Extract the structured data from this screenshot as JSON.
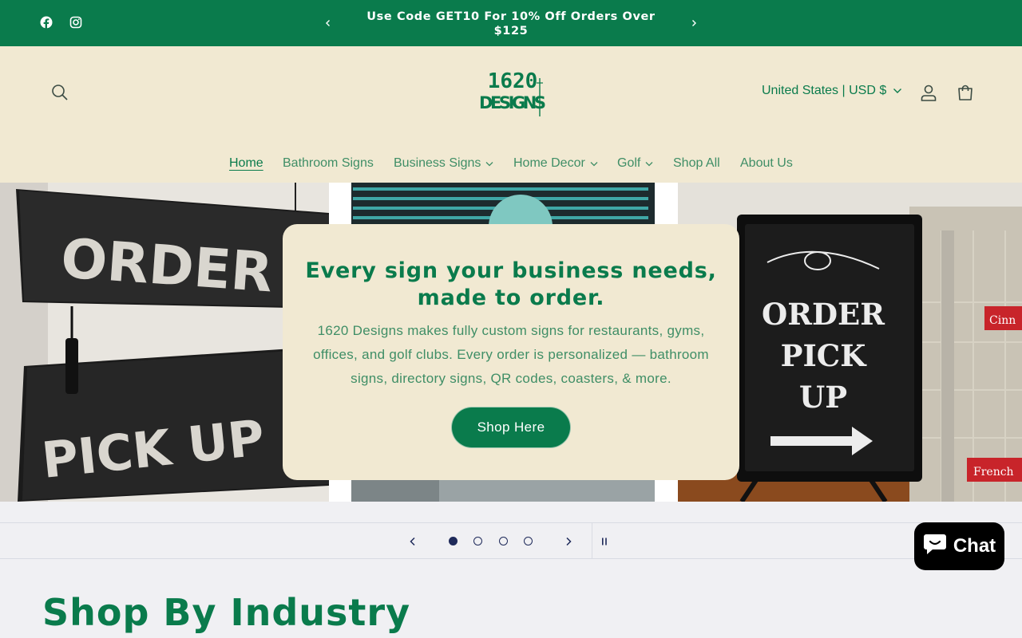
{
  "announcement": {
    "text": "Use Code GET10 For 10% Off Orders Over $125",
    "social": [
      "facebook-icon",
      "instagram-icon"
    ]
  },
  "header": {
    "logo_text_top": "1620",
    "logo_text_bottom": "DESIGNS",
    "country": "United States | USD $"
  },
  "nav": {
    "items": [
      {
        "label": "Home",
        "active": true
      },
      {
        "label": "Bathroom Signs"
      },
      {
        "label": "Business Signs",
        "dropdown": true
      },
      {
        "label": "Home Decor",
        "dropdown": true
      },
      {
        "label": "Golf",
        "dropdown": true
      },
      {
        "label": "Shop All"
      },
      {
        "label": "About Us"
      }
    ]
  },
  "hero": {
    "heading": "Every sign your business needs, made to order.",
    "body": "1620 Designs makes fully custom signs for restaurants, gyms, offices, and golf clubs. Every order is personalized — bathroom signs, directory signs, QR codes, coasters, & more.",
    "button": "Shop Here",
    "left_sign_line1": "ORDER HER",
    "left_sign_line2": "PICK UP HE",
    "right_sign_lines": [
      "ORDER",
      "PICK",
      "UP"
    ],
    "right_tag1": "Cinn",
    "right_tag2": "French"
  },
  "slider": {
    "slides": 4,
    "active": 1
  },
  "section": {
    "title": "Shop By Industry"
  },
  "chat": {
    "label": "Chat"
  },
  "colors": {
    "brand_green": "#0a7b4c",
    "cream": "#f1e9d2",
    "navy": "#1f2a5a"
  }
}
